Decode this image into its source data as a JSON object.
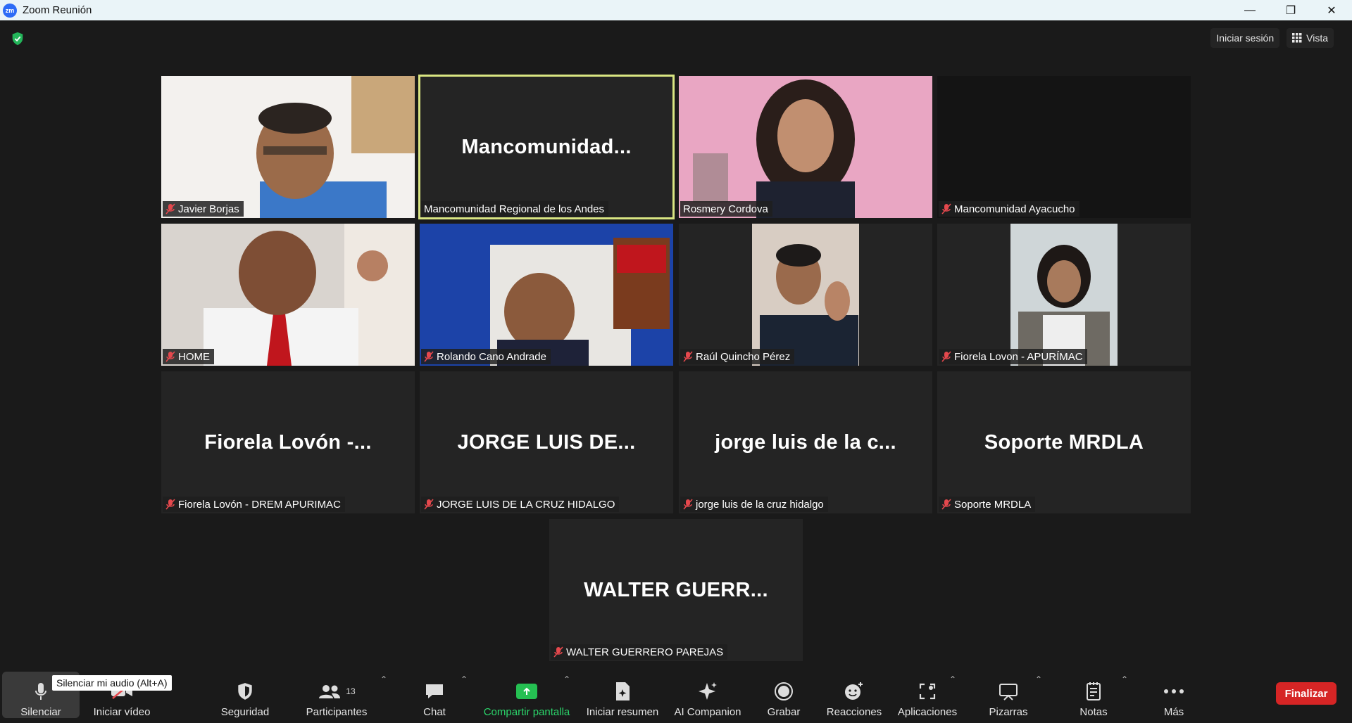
{
  "window": {
    "app_icon": "zm",
    "title": "Zoom Reunión",
    "controls": [
      "minimize",
      "restore",
      "close"
    ]
  },
  "topbar": {
    "sign_in": "Iniciar sesión",
    "view": "Vista"
  },
  "tiles": [
    {
      "name": "Javier Borjas",
      "muted": true,
      "video": true
    },
    {
      "name": "Mancomunidad Regional de los Andes",
      "display": "Mancomunidad...",
      "muted": false,
      "video": false,
      "active": true
    },
    {
      "name": "Rosmery Cordova",
      "muted": false,
      "video": true
    },
    {
      "name": "Mancomunidad Ayacucho",
      "muted": true,
      "video": false
    },
    {
      "name": "HOME",
      "muted": true,
      "video": true
    },
    {
      "name": "Rolando Cano Andrade",
      "muted": true,
      "video": true
    },
    {
      "name": "Raúl Quincho Pérez",
      "muted": true,
      "video": true
    },
    {
      "name": "Fiorela Lovon - APURÍMAC",
      "muted": true,
      "video": true
    },
    {
      "name": "Fiorela Lovón - DREM APURIMAC",
      "display": "Fiorela Lovón -...",
      "muted": true,
      "video": false
    },
    {
      "name": "JORGE LUIS DE LA CRUZ HIDALGO",
      "display": "JORGE LUIS DE...",
      "muted": true,
      "video": false
    },
    {
      "name": "jorge luis de la cruz hidalgo",
      "display": "jorge luis de la c...",
      "muted": true,
      "video": false
    },
    {
      "name": "Soporte MRDLA",
      "display": "Soporte MRDLA",
      "muted": true,
      "video": false
    },
    {
      "name": "WALTER GUERRERO PAREJAS",
      "display": "WALTER  GUERR...",
      "muted": true,
      "video": false
    }
  ],
  "toolbar": {
    "mute": "Silenciar",
    "mute_tooltip": "Silenciar mi audio (Alt+A)",
    "video": "Iniciar vídeo",
    "security": "Seguridad",
    "participants": "Participantes",
    "participants_count": "13",
    "chat": "Chat",
    "share": "Compartir pantalla",
    "summary": "Iniciar resumen",
    "companion": "AI Companion",
    "record": "Grabar",
    "reactions": "Reacciones",
    "apps": "Aplicaciones",
    "whiteboards": "Pizarras",
    "notes": "Notas",
    "more": "Más",
    "end": "Finalizar"
  },
  "colors": {
    "background": "#1a1a1a",
    "tile": "#242424",
    "active_border": "#d9e582",
    "muted_red": "#e5484d",
    "share_green": "#25c052",
    "end_red": "#d62525"
  }
}
